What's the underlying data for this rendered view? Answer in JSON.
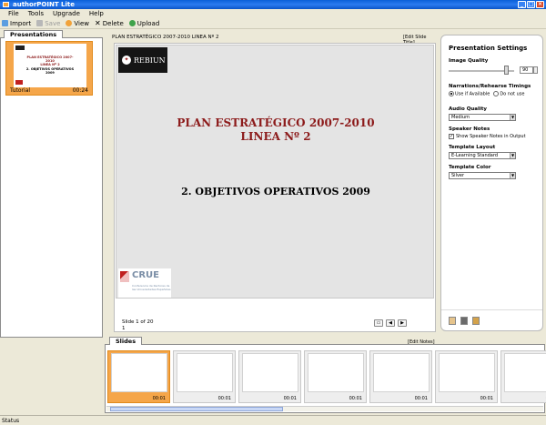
{
  "window": {
    "title": "authorPOINT Lite"
  },
  "menu": [
    "File",
    "Tools",
    "Upgrade",
    "Help"
  ],
  "toolbar": {
    "import": "Import",
    "save": "Save",
    "view": "View",
    "delete": "Delete",
    "upload": "Upload"
  },
  "presentations": {
    "tab": "Presentations",
    "items": [
      {
        "name": "Tutorial",
        "duration": "00:24"
      }
    ]
  },
  "slide": {
    "header_title": "PLAN ESTRATÉGICO 2007-2010   LINEA Nº 2",
    "edit_title": "[Edit Slide Title]",
    "logo_text": "REBIUN",
    "title_line1": "PLAN ESTRATÉGICO 2007-2010",
    "title_line2": "LINEA Nº 2",
    "subtitle": "2. OBJETIVOS OPERATIVOS 2009",
    "crue_logo": "CRUE",
    "crue_caption": "Conferencia de Rectores de las Universidades Españolas",
    "counter": "Slide 1 of 20",
    "number": "1",
    "edit_notes": "[Edit Notes]"
  },
  "settings": {
    "title": "Presentation Settings",
    "image_quality_label": "Image Quality",
    "image_quality_value": "90",
    "image_quality_fraction": 0.9,
    "narrations_label": "Narrations/Rehearse Timings",
    "use_if_available": "Use if Available",
    "do_not_use": "Do not use",
    "audio_quality_label": "Audio Quality",
    "audio_quality_value": "Medium",
    "speaker_notes_label": "Speaker Notes",
    "show_speaker_notes": "Show Speaker Notes in Output",
    "template_layout_label": "Template Layout",
    "template_layout_value": "E-Learning Standard",
    "template_color_label": "Template Color",
    "template_color_value": "Silver"
  },
  "slides_strip": {
    "tab": "Slides",
    "items": [
      {
        "duration": "00:01",
        "active": true
      },
      {
        "duration": "00:01",
        "active": false
      },
      {
        "duration": "00:01",
        "active": false
      },
      {
        "duration": "00:01",
        "active": false
      },
      {
        "duration": "00:01",
        "active": false
      },
      {
        "duration": "00:01",
        "active": false
      },
      {
        "duration": "00:01",
        "active": false
      }
    ]
  },
  "status": "Status",
  "colors": {
    "accent": "#f5a64a",
    "title_red": "#8c1a1a",
    "titlebar": "#0a5fd8"
  }
}
